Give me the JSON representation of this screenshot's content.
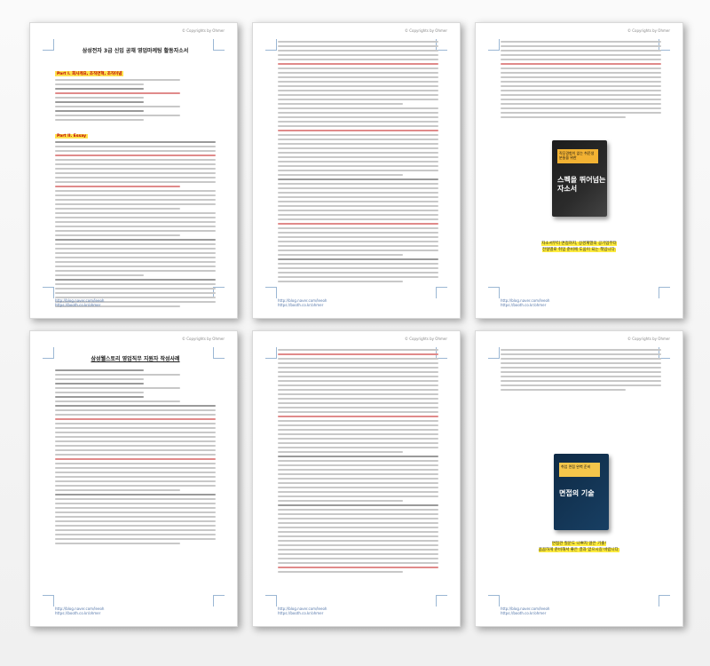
{
  "copyright": "© Copyrights by Ohmer",
  "footer": {
    "line1": "http://blog.naver.com/leeoh",
    "line2": "https://booth.co.kr/ohmer"
  },
  "pages": [
    {
      "title": "삼성전자 3급 신입 공채 영업마케팅 활동자소서",
      "section1": "Part I. 회사개요, 조직연혁, 조직이념",
      "section2": "Part II. Essay"
    },
    {},
    {
      "book_title": "스펙을 뛰어넘는 자소서",
      "book_top": "직무경험이 없는 취준생 분들을 위한",
      "caption_line1": "자소서부터 면접까지, 상경계열의 공기업부터",
      "caption_line2": "전형별로 취업 준비에 도움이 되는 책입니다."
    },
    {
      "title": "삼성웰스토리 영업직무 지원자 작성사례"
    },
    {},
    {
      "book_title": "면접의 기술",
      "book_top": "취업 면접 완벽 준비",
      "caption_line1": "면접관 질문도 나쁘지 않은 기출!",
      "caption_line2": "꼼꼼하게 준비해서 좋은 결과 얻으시길 바랍니다."
    }
  ]
}
